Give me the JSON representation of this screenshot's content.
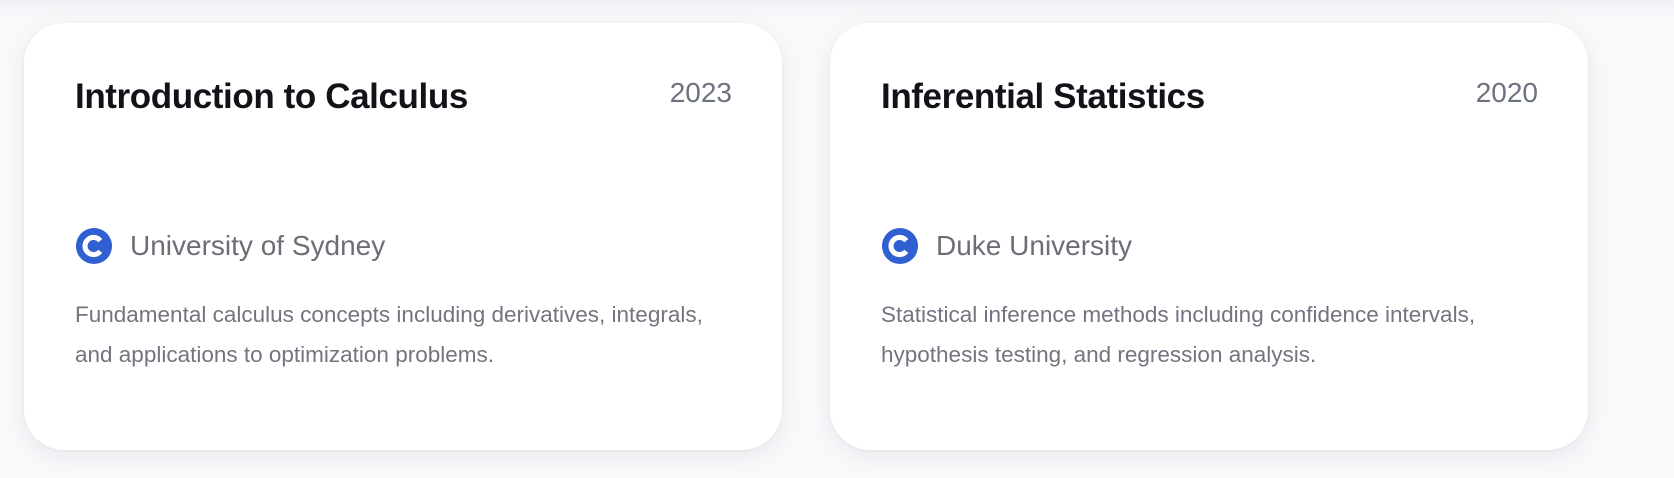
{
  "cards": [
    {
      "title": "Introduction to Calculus",
      "year": "2023",
      "organization": "University of Sydney",
      "organization_icon": "coursera-c-icon",
      "description": "Fundamental calculus concepts including derivatives, integrals, and applications to optimization problems."
    },
    {
      "title": "Inferential Statistics",
      "year": "2020",
      "organization": "Duke University",
      "organization_icon": "coursera-c-icon",
      "description": "Statistical inference methods including confidence intervals, hypothesis testing, and regression analysis."
    }
  ],
  "colors": {
    "icon_blue": "#2f5fd0",
    "title": "#111318",
    "muted_text": "#727580",
    "card_background": "#ffffff",
    "page_background": "#f8f9fb"
  }
}
